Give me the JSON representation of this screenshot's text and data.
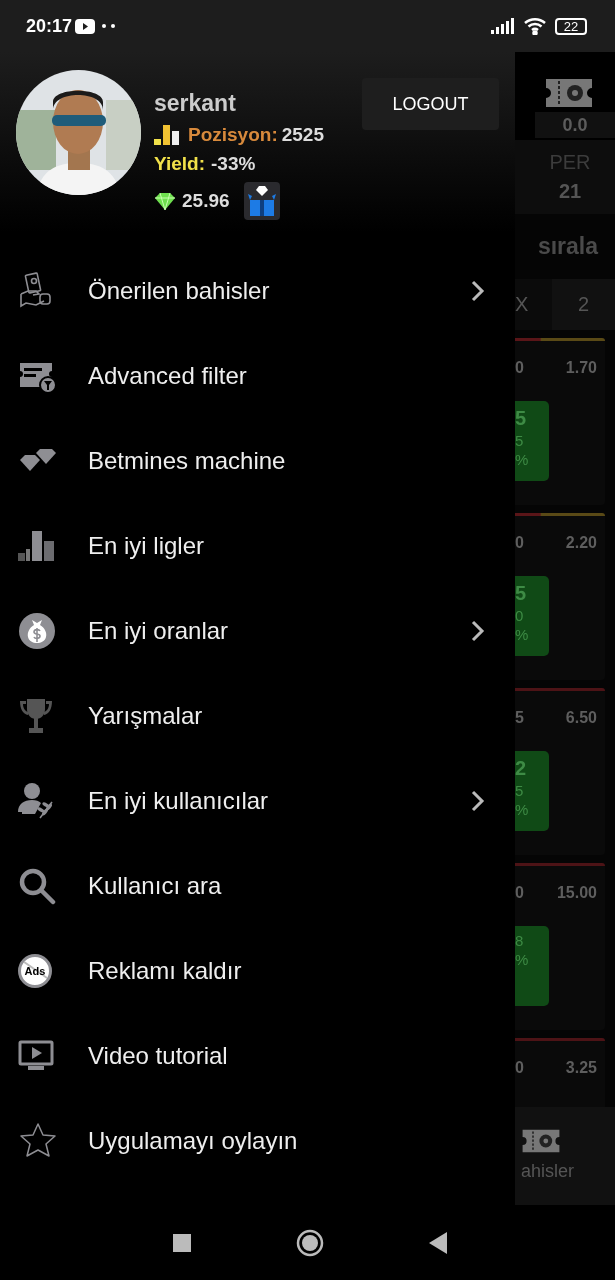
{
  "status_bar": {
    "time": "20:17",
    "battery": "22"
  },
  "drawer": {
    "profile": {
      "username": "serkant",
      "position_label": "Pozisyon:",
      "position_value": "2525",
      "yield_label": "Yield:",
      "yield_value": "-33%",
      "diamonds": "25.96"
    },
    "logout_button": "LOGOUT",
    "items": [
      {
        "kind": "tips",
        "label": "Önerilen bahisler",
        "submenu": true
      },
      {
        "kind": "filter",
        "label": "Advanced filter",
        "submenu": false
      },
      {
        "kind": "diamonds",
        "label": "Betmines machine",
        "submenu": false
      },
      {
        "kind": "bars",
        "label": "En iyi ligler",
        "submenu": false
      },
      {
        "kind": "money",
        "label": "En iyi oranlar",
        "submenu": true
      },
      {
        "kind": "trophy",
        "label": "Yarışmalar",
        "submenu": false
      },
      {
        "kind": "users",
        "label": "En iyi kullanıcılar",
        "submenu": true
      },
      {
        "kind": "search",
        "label": "Kullanıcı ara",
        "submenu": false
      },
      {
        "kind": "ads",
        "label": "Reklamı kaldır",
        "submenu": false,
        "icon_text": "Ads"
      },
      {
        "kind": "video",
        "label": "Video tutorial",
        "submenu": false
      },
      {
        "kind": "star",
        "label": "Uygulamayı oylayın",
        "submenu": false
      }
    ]
  },
  "background_screen": {
    "balance": "0.0",
    "column_label": "PER",
    "column_value": "21",
    "sort_label": "sırala",
    "odds_headers": [
      "X",
      "2"
    ],
    "cards": [
      {
        "odds": [
          "0",
          "1.70"
        ],
        "tip": [
          "5",
          "5",
          "%"
        ]
      },
      {
        "odds": [
          "0",
          "2.20"
        ],
        "tip": [
          "5",
          "0",
          "%"
        ]
      },
      {
        "odds": [
          "5",
          "6.50"
        ],
        "tip": [
          "2",
          "5",
          "%"
        ]
      },
      {
        "odds": [
          "0",
          "15.00"
        ],
        "tip": [
          "8",
          "%"
        ]
      },
      {
        "odds": [
          "0",
          "3.25"
        ]
      }
    ],
    "bottom_tab": "ahisler"
  }
}
